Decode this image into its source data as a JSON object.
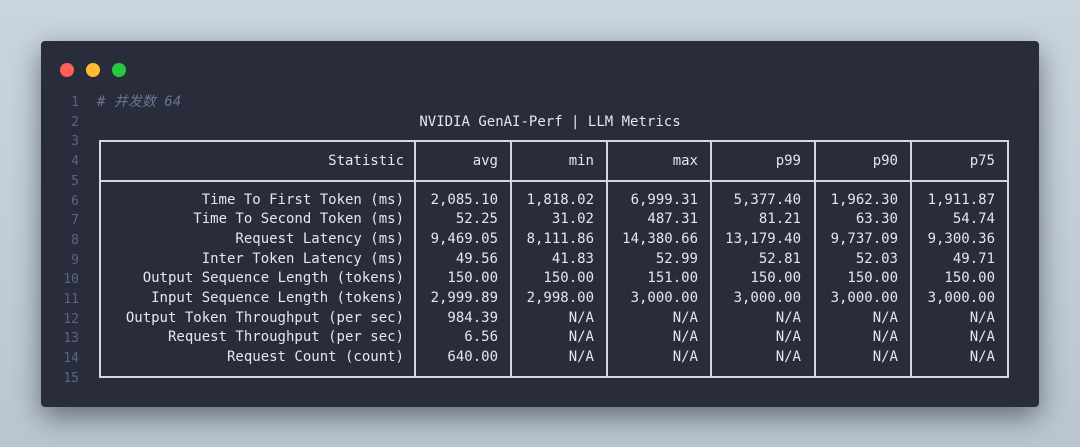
{
  "window": {
    "buttons": [
      "close",
      "minimize",
      "maximize"
    ],
    "colors": {
      "background": "#282c3b",
      "text": "#e4e7ee",
      "line_number": "#5c6481",
      "comment": "#6b7494",
      "border": "#d4d8e0"
    }
  },
  "line_numbers": [
    "1",
    "2",
    "3",
    "4",
    "5",
    "6",
    "7",
    "8",
    "9",
    "10",
    "11",
    "12",
    "13",
    "14",
    "15"
  ],
  "comment": "# 并发数 64",
  "table": {
    "title": "NVIDIA GenAI-Perf | LLM Metrics",
    "columns": [
      "Statistic",
      "avg",
      "min",
      "max",
      "p99",
      "p90",
      "p75"
    ],
    "rows": [
      [
        "Time To First Token (ms)",
        "2,085.10",
        "1,818.02",
        "6,999.31",
        "5,377.40",
        "1,962.30",
        "1,911.87"
      ],
      [
        "Time To Second Token (ms)",
        "52.25",
        "31.02",
        "487.31",
        "81.21",
        "63.30",
        "54.74"
      ],
      [
        "Request Latency (ms)",
        "9,469.05",
        "8,111.86",
        "14,380.66",
        "13,179.40",
        "9,737.09",
        "9,300.36"
      ],
      [
        "Inter Token Latency (ms)",
        "49.56",
        "41.83",
        "52.99",
        "52.81",
        "52.03",
        "49.71"
      ],
      [
        "Output Sequence Length (tokens)",
        "150.00",
        "150.00",
        "151.00",
        "150.00",
        "150.00",
        "150.00"
      ],
      [
        "Input Sequence Length (tokens)",
        "2,999.89",
        "2,998.00",
        "3,000.00",
        "3,000.00",
        "3,000.00",
        "3,000.00"
      ],
      [
        "Output Token Throughput (per sec)",
        "984.39",
        "N/A",
        "N/A",
        "N/A",
        "N/A",
        "N/A"
      ],
      [
        "Request Throughput (per sec)",
        "6.56",
        "N/A",
        "N/A",
        "N/A",
        "N/A",
        "N/A"
      ],
      [
        "Request Count (count)",
        "640.00",
        "N/A",
        "N/A",
        "N/A",
        "N/A",
        "N/A"
      ]
    ]
  }
}
